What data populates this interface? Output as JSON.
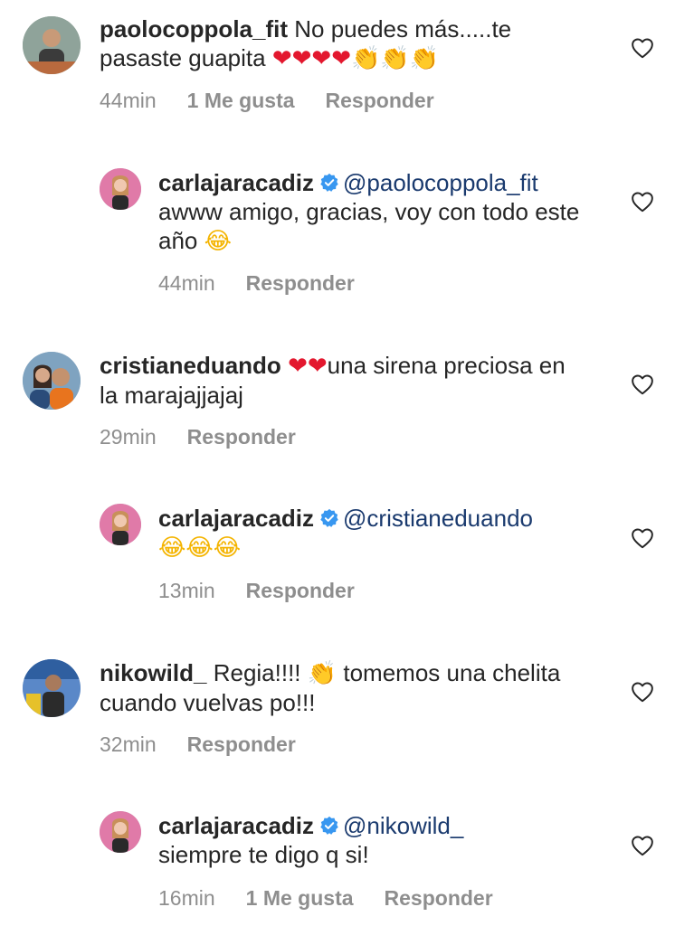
{
  "comments": [
    {
      "username": "paolocoppola_fit",
      "text": "No puedes más.....te pasaste  guapita",
      "emojis": [
        "❤",
        "❤",
        "❤",
        "❤",
        "👏",
        "👏",
        "👏"
      ],
      "time": "44min",
      "likes": "1 Me gusta",
      "reply_label": "Responder",
      "like_icon": "heart-outline-icon"
    },
    {
      "username": "carlajaracadiz",
      "verified": true,
      "mention": "@paolocoppola_fit",
      "text": "awww amigo, gracias, voy con todo este año",
      "emojis": [
        "😂"
      ],
      "time": "44min",
      "reply_label": "Responder",
      "like_icon": "heart-outline-icon"
    },
    {
      "username": "cristianeduando",
      "emojis_before": [
        "❤",
        "❤"
      ],
      "text": "una sirena preciosa  en la marajajjajaj",
      "time": "29min",
      "reply_label": "Responder",
      "like_icon": "heart-outline-icon"
    },
    {
      "username": "carlajaracadiz",
      "verified": true,
      "mention": "@cristianeduando",
      "emojis": [
        "😂",
        "😂",
        "😂"
      ],
      "time": "13min",
      "reply_label": "Responder",
      "like_icon": "heart-outline-icon"
    },
    {
      "username": "nikowild_",
      "text_a": "Regia!!!!",
      "emojis": [
        "👏"
      ],
      "text_b": "tomemos una chelita cuando vuelvas po!!!",
      "time": "32min",
      "reply_label": "Responder",
      "like_icon": "heart-outline-icon"
    },
    {
      "username": "carlajaracadiz",
      "verified": true,
      "mention": "@nikowild_",
      "text": "siempre te digo q si!",
      "time": "16min",
      "likes": "1 Me gusta",
      "reply_label": "Responder",
      "like_icon": "heart-outline-icon"
    }
  ],
  "colors": {
    "username": "#262626",
    "mention": "#1a3a6e",
    "meta": "#8e8e8e",
    "heart_emoji": "#e3172e",
    "verified_badge": "#3897f0"
  }
}
